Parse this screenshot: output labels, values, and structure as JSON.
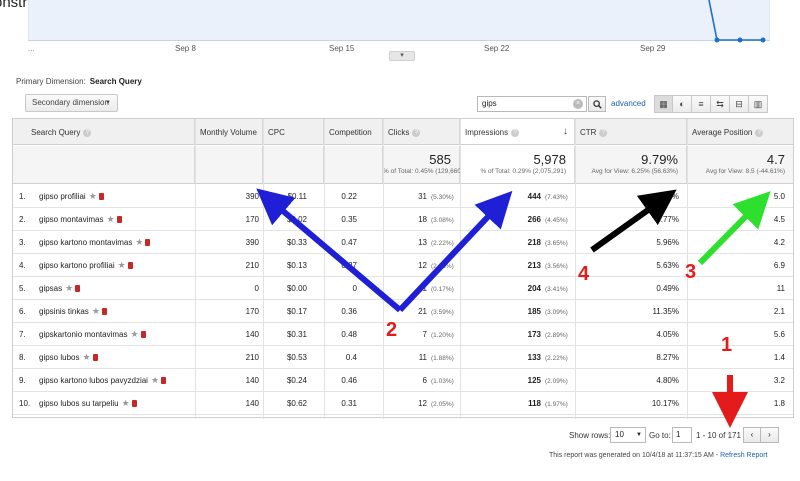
{
  "header": {
    "site_title": "onstructions.com"
  },
  "chart": {
    "x_labels": [
      "Sep 8",
      "Sep 15",
      "Sep 22",
      "Sep 29"
    ],
    "collapse_glyph": "▾",
    "leading_dots": "...",
    "line_color": "#1e6fc9"
  },
  "dimension": {
    "primary_label": "Primary Dimension:",
    "primary_value": "Search Query",
    "secondary_button": "Secondary dimension"
  },
  "search": {
    "value": "gips",
    "clear_glyph": "×",
    "search_glyph": "🔍",
    "advanced_label": "advanced"
  },
  "view_icons": [
    "▦",
    "◐",
    "≡",
    "⇆",
    "⊟",
    "▥"
  ],
  "table": {
    "columns": {
      "query": "Search Query",
      "volume": "Monthly Volume",
      "cpc": "CPC",
      "competition": "Competition",
      "clicks": "Clicks",
      "impressions": "Impressions",
      "ctr": "CTR",
      "position": "Average Position"
    },
    "help_glyph": "?",
    "sort_glyph": "↓",
    "totals": {
      "clicks_big": "585",
      "clicks_small": "% of Total: 0.45% (129,660)",
      "impressions_big": "5,978",
      "impressions_small": "% of Total: 0.29% (2,075,291)",
      "ctr_big": "9.79%",
      "ctr_small": "Avg for View: 6.25% (56.63%)",
      "position_big": "4.7",
      "position_small": "Avg for View: 8.5 (-44.61%)"
    },
    "rows": [
      {
        "idx": "1.",
        "query": "gipso profiliai",
        "volume": "390",
        "cpc": "$0.11",
        "competition": "0.22",
        "clicks": "31",
        "clicks_pct": "(5.30%)",
        "impressions": "444",
        "impressions_pct": "(7.43%)",
        "ctr": "6.98%",
        "position": "5.0"
      },
      {
        "idx": "2.",
        "query": "gipso montavimas",
        "volume": "170",
        "cpc": "$0.02",
        "competition": "0.35",
        "clicks": "18",
        "clicks_pct": "(3.08%)",
        "impressions": "266",
        "impressions_pct": "(4.45%)",
        "ctr": "6.77%",
        "position": "4.5"
      },
      {
        "idx": "3.",
        "query": "gipso kartono montavimas",
        "volume": "390",
        "cpc": "$0.33",
        "competition": "0.47",
        "clicks": "13",
        "clicks_pct": "(2.22%)",
        "impressions": "218",
        "impressions_pct": "(3.65%)",
        "ctr": "5.96%",
        "position": "4.2"
      },
      {
        "idx": "4.",
        "query": "gipso kartono profiliai",
        "volume": "210",
        "cpc": "$0.13",
        "competition": "0.27",
        "clicks": "12",
        "clicks_pct": "(2.05%)",
        "impressions": "213",
        "impressions_pct": "(3.56%)",
        "ctr": "5.63%",
        "position": "6.9"
      },
      {
        "idx": "5.",
        "query": "gipsas",
        "volume": "0",
        "cpc": "$0.00",
        "competition": "0",
        "clicks": "1",
        "clicks_pct": "(0.17%)",
        "impressions": "204",
        "impressions_pct": "(3.41%)",
        "ctr": "0.49%",
        "position": "11"
      },
      {
        "idx": "6.",
        "query": "gipsinis tinkas",
        "volume": "170",
        "cpc": "$0.17",
        "competition": "0.36",
        "clicks": "21",
        "clicks_pct": "(3.59%)",
        "impressions": "185",
        "impressions_pct": "(3.09%)",
        "ctr": "11.35%",
        "position": "2.1"
      },
      {
        "idx": "7.",
        "query": "gipskartonio montavimas",
        "volume": "140",
        "cpc": "$0.31",
        "competition": "0.48",
        "clicks": "7",
        "clicks_pct": "(1.20%)",
        "impressions": "173",
        "impressions_pct": "(2.89%)",
        "ctr": "4.05%",
        "position": "5.6"
      },
      {
        "idx": "8.",
        "query": "gipso lubos",
        "volume": "210",
        "cpc": "$0.53",
        "competition": "0.4",
        "clicks": "11",
        "clicks_pct": "(1.88%)",
        "impressions": "133",
        "impressions_pct": "(2.22%)",
        "ctr": "8.27%",
        "position": "1.4"
      },
      {
        "idx": "9.",
        "query": "gipso kartono lubos pavyzdziai",
        "volume": "140",
        "cpc": "$0.24",
        "competition": "0.46",
        "clicks": "6",
        "clicks_pct": "(1.03%)",
        "impressions": "125",
        "impressions_pct": "(2.09%)",
        "ctr": "4.80%",
        "position": "3.2"
      },
      {
        "idx": "10.",
        "query": "gipso lubos su tarpeliu",
        "volume": "140",
        "cpc": "$0.62",
        "competition": "0.31",
        "clicks": "12",
        "clicks_pct": "(2.05%)",
        "impressions": "118",
        "impressions_pct": "(1.97%)",
        "ctr": "10.17%",
        "position": "1.8"
      }
    ]
  },
  "footer": {
    "show_rows_label": "Show rows:",
    "rows_value": "10",
    "goto_label": "Go to:",
    "goto_value": "1",
    "range": "1 - 10 of 171",
    "prev_glyph": "‹",
    "next_glyph": "›",
    "generated_text": "This report was generated on 10/4/18 at 11:37:15 AM - ",
    "refresh_label": "Refresh Report"
  },
  "annotations": {
    "numbers": [
      "1",
      "2",
      "3",
      "4"
    ],
    "arrow_colors": {
      "red": "#e31b1b",
      "blue": "#1f1fd6",
      "black": "#000000",
      "green": "#2ee02e"
    }
  }
}
